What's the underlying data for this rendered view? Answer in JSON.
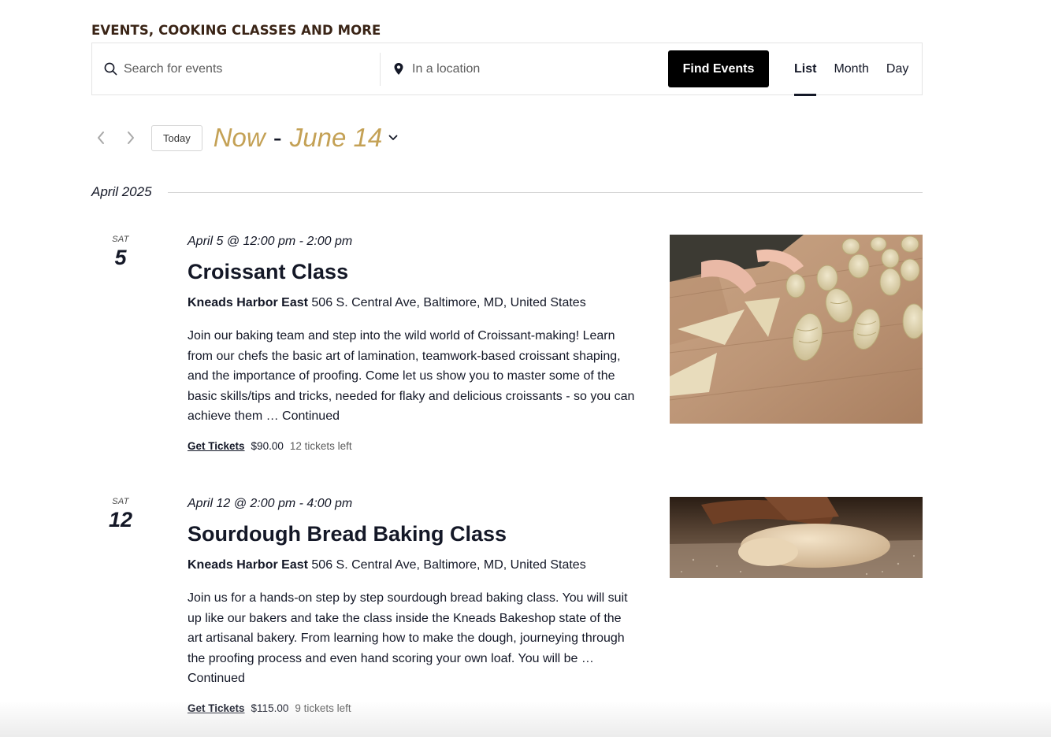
{
  "header": {
    "title": "EVENTS, COOKING CLASSES AND MORE"
  },
  "search": {
    "keyword_placeholder": "Search for events",
    "location_placeholder": "In a location",
    "submit_label": "Find Events"
  },
  "views": [
    {
      "label": "List",
      "active": true
    },
    {
      "label": "Month",
      "active": false
    },
    {
      "label": "Day",
      "active": false
    }
  ],
  "navigation": {
    "today_label": "Today",
    "range_start": "Now",
    "range_separator": "-",
    "range_end": "June 14"
  },
  "month_separator": "April 2025",
  "events": [
    {
      "day_of_week": "SAT",
      "day": "5",
      "time": "April 5 @ 12:00 pm - 2:00 pm",
      "title": "Croissant Class",
      "venue_name": "Kneads Harbor East",
      "venue_address": "506 S. Central Ave, Baltimore, MD, United States",
      "description": "Join our baking team and step into the wild world of Croissant-making! Learn from our chefs the basic art of lamination, teamwork-based croissant shaping, and the importance of proofing. Come let us show you to master some of the basic skills/tips and tricks, needed for flaky and delicious croissants - so you can achieve them … Continued",
      "tickets_label": "Get Tickets",
      "price": "$90.00",
      "tickets_left": "12 tickets left",
      "image": "croissant-photo"
    },
    {
      "day_of_week": "SAT",
      "day": "12",
      "time": "April 12 @ 2:00 pm - 4:00 pm",
      "title": "Sourdough Bread Baking Class",
      "venue_name": "Kneads Harbor East",
      "venue_address": "506 S. Central Ave, Baltimore, MD, United States",
      "description": "Join us for a hands-on step by step sourdough bread baking class. You will suit up like our bakers and take the class inside the Kneads Bakeshop state of the art artisanal bakery. From learning how to make the dough, journeying through the proofing process and even hand scoring your own loaf. You will be … Continued",
      "tickets_label": "Get Tickets",
      "price": "$115.00",
      "tickets_left": "9 tickets left",
      "image": "dough-photo"
    }
  ],
  "icons": {
    "search": "search-icon",
    "location": "map-pin-icon",
    "prev": "chevron-left-icon",
    "next": "chevron-right-icon",
    "range": "chevron-down-icon"
  },
  "colors": {
    "heading": "#3a2416",
    "accent_gold": "#c4a155",
    "button_bg": "#000000",
    "text": "#141827"
  }
}
